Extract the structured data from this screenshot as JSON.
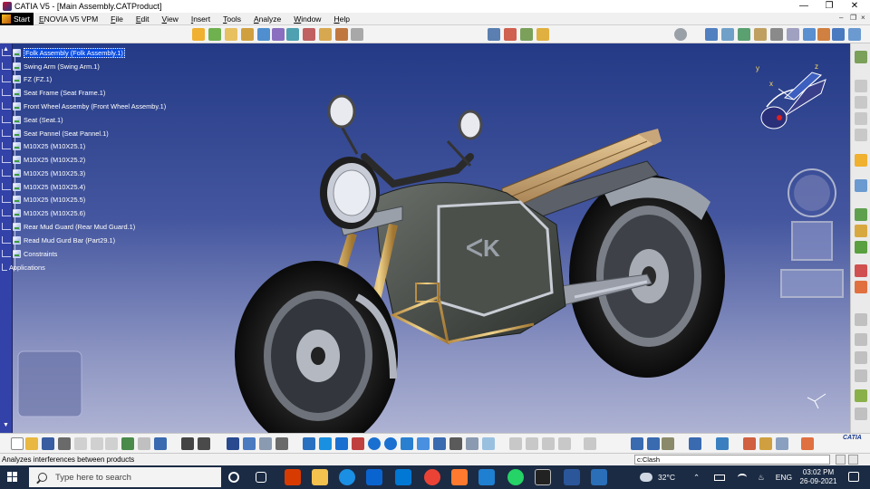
{
  "window": {
    "title": "CATIA V5 - [Main Assembly.CATProduct]",
    "controls": [
      "minimize",
      "restore",
      "close"
    ]
  },
  "menu": {
    "start_label": "Start",
    "items": [
      "ENOVIA V5 VPM",
      "File",
      "Edit",
      "View",
      "Insert",
      "Tools",
      "Analyze",
      "Window",
      "Help"
    ]
  },
  "tree": {
    "items": [
      {
        "label": "Folk Assembly (Folk Assembly.1)",
        "selected": true
      },
      {
        "label": "Swing Arm (Swing Arm.1)"
      },
      {
        "label": "FZ (FZ.1)"
      },
      {
        "label": "Seat Frame (Seat Frame.1)"
      },
      {
        "label": "Front Wheel Assemby (Front Wheel Assemby.1)"
      },
      {
        "label": "Seat (Seat.1)"
      },
      {
        "label": "Seat Pannel (Seat Pannel.1)"
      },
      {
        "label": "M10X25 (M10X25.1)"
      },
      {
        "label": "M10X25 (M10X25.2)"
      },
      {
        "label": "M10X25 (M10X25.3)"
      },
      {
        "label": "M10X25 (M10X25.4)"
      },
      {
        "label": "M10X25 (M10X25.5)"
      },
      {
        "label": "M10X25 (M10X25.6)"
      },
      {
        "label": "Rear Mud Guard (Rear Mud Guard.1)"
      },
      {
        "label": "Read Mud Gurd Bar (Part29.1)"
      },
      {
        "label": "Constraints"
      },
      {
        "label": "Applications"
      }
    ]
  },
  "compass": {
    "x": "x",
    "y": "y",
    "z": "z"
  },
  "status": {
    "message": "Analyzes interferences between products",
    "command": "c:Clash"
  },
  "taskbar": {
    "search_placeholder": "Type here to search",
    "weather": "32°C",
    "language": "ENG",
    "time": "03:02 PM",
    "date": "26-09-2021"
  },
  "brand": {
    "catia_logo": "CATIA"
  },
  "colors": {
    "viewport_top": "#243a86",
    "viewport_bottom": "#aeb3d3",
    "selection": "#0a4ce0",
    "taskbar": "#1b2b44"
  }
}
